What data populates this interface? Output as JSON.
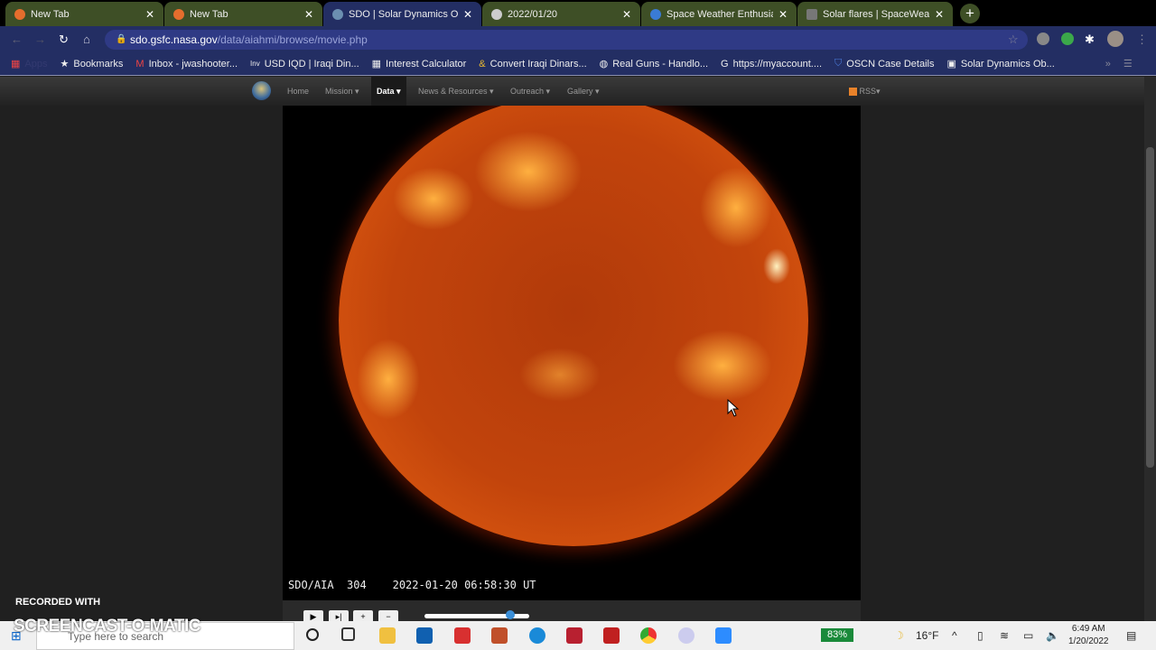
{
  "tabs": [
    {
      "title": "New Tab",
      "color": "#e56d2d"
    },
    {
      "title": "New Tab",
      "color": "#e56d2d"
    },
    {
      "title": "SDO | Solar Dynamics Obse",
      "color": "#6b8fb0"
    },
    {
      "title": "2022/01/20",
      "color": "#cccccc"
    },
    {
      "title": "Space Weather Enthusiasts",
      "color": "#3a7bd5"
    },
    {
      "title": "Solar flares | SpaceWeather",
      "color": "#777777"
    }
  ],
  "url": {
    "domain": "sdo.gsfc.nasa.gov",
    "path": "/data/aiahmi/browse/movie.php"
  },
  "bookmarks": [
    "Apps",
    "Bookmarks",
    "Inbox - jwashooter...",
    "USD IQD | Iraqi Din...",
    "Interest Calculator",
    "Convert Iraqi Dinars...",
    "Real Guns - Handlo...",
    "https://myaccount....",
    "OSCN Case Details",
    "Solar Dynamics Ob..."
  ],
  "nav": {
    "home": "Home",
    "mission": "Mission",
    "data": "Data",
    "news": "News & Resources",
    "outreach": "Outreach",
    "gallery": "Gallery",
    "rss": "RSS"
  },
  "video": {
    "caption": "SDO/AIA  304    2022-01-20 06:58:30 UT",
    "progress": 0.82
  },
  "taskbar": {
    "search_placeholder": "Type here to search",
    "battery": "83%",
    "weather": "16°F",
    "time": "6:49 AM",
    "date": "1/20/2022"
  },
  "watermark": {
    "line1": "RECORDED WITH",
    "line2": "SCREENCAST-O-MATIC"
  }
}
